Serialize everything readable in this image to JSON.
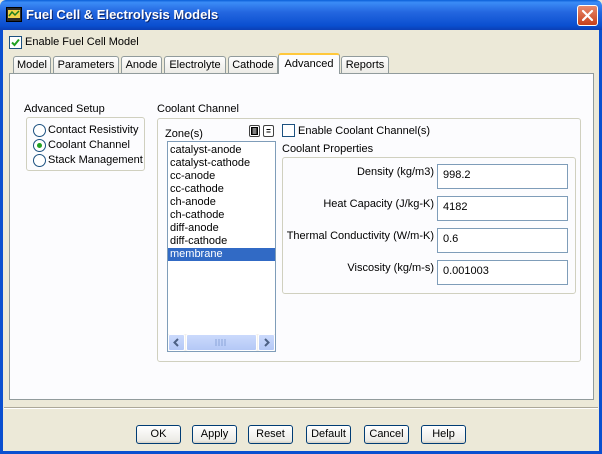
{
  "window": {
    "title": "Fuel Cell & Electrolysis Models",
    "close_icon": "close-icon",
    "app_icon": "fluent-icon"
  },
  "enable_fuel_cell": {
    "label": "Enable Fuel Cell Model",
    "checked": true
  },
  "tabs": [
    {
      "label": "Model"
    },
    {
      "label": "Parameters"
    },
    {
      "label": "Anode"
    },
    {
      "label": "Electrolyte"
    },
    {
      "label": "Cathode"
    },
    {
      "label": "Advanced",
      "active": true
    },
    {
      "label": "Reports"
    }
  ],
  "advanced_setup": {
    "title": "Advanced Setup",
    "options": [
      {
        "label": "Contact Resistivity",
        "selected": false
      },
      {
        "label": "Coolant Channel",
        "selected": true
      },
      {
        "label": "Stack Management",
        "selected": false
      }
    ]
  },
  "coolant_channel": {
    "title": "Coolant Channel",
    "zones_label": "Zone(s)",
    "zones": [
      "catalyst-anode",
      "catalyst-cathode",
      "cc-anode",
      "cc-cathode",
      "ch-anode",
      "ch-cathode",
      "diff-anode",
      "diff-cathode",
      "membrane"
    ],
    "selected_zone": "membrane",
    "enable_label": "Enable Coolant Channel(s)",
    "enable_checked": false,
    "properties_title": "Coolant Properties",
    "properties": [
      {
        "label": "Density (kg/m3)",
        "value": "998.2"
      },
      {
        "label": "Heat Capacity (J/kg-K)",
        "value": "4182"
      },
      {
        "label": "Thermal Conductivity (W/m-K)",
        "value": "0.6"
      },
      {
        "label": "Viscosity (kg/m-s)",
        "value": "0.001003"
      }
    ]
  },
  "buttons": {
    "ok": "OK",
    "apply": "Apply",
    "reset": "Reset",
    "default": "Default",
    "cancel": "Cancel",
    "help": "Help"
  },
  "colors": {
    "titlebar": "#0a4fd0",
    "selection": "#316ac5",
    "active_tab_accent": "#ffc83c",
    "radio_dot": "#21a121"
  }
}
